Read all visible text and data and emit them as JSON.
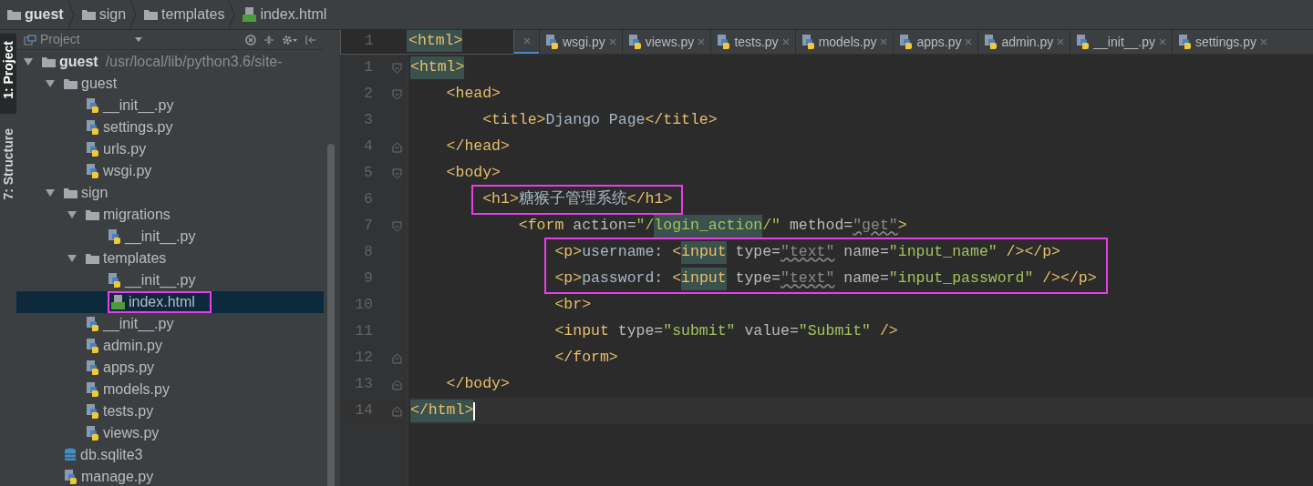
{
  "breadcrumb": [
    {
      "label": "guest",
      "kind": "folder",
      "bold": true
    },
    {
      "label": "sign",
      "kind": "folder",
      "bold": false
    },
    {
      "label": "templates",
      "kind": "folder",
      "bold": false
    },
    {
      "label": "index.html",
      "kind": "html",
      "bold": false
    }
  ],
  "tool_strip": [
    {
      "label": "1: Project",
      "selected": true
    },
    {
      "label": "7: Structure",
      "selected": false
    }
  ],
  "project_panel": {
    "title": "Project",
    "tree": [
      {
        "label": "guest",
        "path": "/usr/local/lib/python3.6/site-",
        "kind": "folder",
        "bold": true,
        "expanded": true,
        "selected": false,
        "boxed": false,
        "children": [
          {
            "label": "guest",
            "kind": "folder",
            "expanded": true,
            "selected": false,
            "boxed": false,
            "children": [
              {
                "label": "__init__.py",
                "kind": "python",
                "selected": false,
                "boxed": false
              },
              {
                "label": "settings.py",
                "kind": "python",
                "selected": false,
                "boxed": false
              },
              {
                "label": "urls.py",
                "kind": "python",
                "selected": false,
                "boxed": false
              },
              {
                "label": "wsgi.py",
                "kind": "python",
                "selected": false,
                "boxed": false
              }
            ]
          },
          {
            "label": "sign",
            "kind": "folder",
            "expanded": true,
            "selected": false,
            "boxed": false,
            "children": [
              {
                "label": "migrations",
                "kind": "folder",
                "expanded": true,
                "selected": false,
                "boxed": false,
                "children": [
                  {
                    "label": "__init__.py",
                    "kind": "python",
                    "selected": false,
                    "boxed": false
                  }
                ]
              },
              {
                "label": "templates",
                "kind": "folder",
                "expanded": true,
                "selected": false,
                "boxed": false,
                "children": [
                  {
                    "label": "__init__.py",
                    "kind": "python",
                    "selected": false,
                    "boxed": false
                  },
                  {
                    "label": "index.html",
                    "kind": "html",
                    "selected": true,
                    "boxed": true
                  }
                ]
              },
              {
                "label": "__init__.py",
                "kind": "python",
                "selected": false,
                "boxed": false
              },
              {
                "label": "admin.py",
                "kind": "python",
                "selected": false,
                "boxed": false
              },
              {
                "label": "apps.py",
                "kind": "python",
                "selected": false,
                "boxed": false
              },
              {
                "label": "models.py",
                "kind": "python",
                "selected": false,
                "boxed": false
              },
              {
                "label": "tests.py",
                "kind": "python",
                "selected": false,
                "boxed": false
              },
              {
                "label": "views.py",
                "kind": "python",
                "selected": false,
                "boxed": false
              }
            ]
          },
          {
            "label": "db.sqlite3",
            "kind": "db",
            "selected": false,
            "boxed": false
          },
          {
            "label": "manage.py",
            "kind": "python",
            "selected": false,
            "boxed": false
          }
        ]
      }
    ]
  },
  "tabs": [
    {
      "label": "wsgi.py",
      "selected": false
    },
    {
      "label": "views.py",
      "selected": false
    },
    {
      "label": "tests.py",
      "selected": false
    },
    {
      "label": "models.py",
      "selected": false
    },
    {
      "label": "apps.py",
      "selected": false
    },
    {
      "label": "admin.py",
      "selected": false
    },
    {
      "label": "__init__.py",
      "selected": false
    },
    {
      "label": "settings.py",
      "selected": false
    }
  ],
  "editor": {
    "sticky_line": {
      "number": "1",
      "text": "<html>"
    },
    "lines": [
      {
        "number": "1",
        "fold_start": true,
        "boxed": false,
        "tokens": [
          {
            "kind": "tag",
            "text": "<html>",
            "highlighted": true
          }
        ]
      },
      {
        "number": "2",
        "fold_start": true,
        "boxed": false,
        "tokens": [
          {
            "kind": "tag",
            "text": "    <head>"
          }
        ]
      },
      {
        "number": "3",
        "boxed": false,
        "tokens": [
          {
            "kind": "tag",
            "text": "        <title>"
          },
          {
            "kind": "text",
            "text": "Django Page"
          },
          {
            "kind": "tag",
            "text": "</title>"
          }
        ]
      },
      {
        "number": "4",
        "fold_end": true,
        "boxed": false,
        "tokens": [
          {
            "kind": "tag",
            "text": "    </head>"
          }
        ]
      },
      {
        "number": "5",
        "fold_start": true,
        "boxed": false,
        "tokens": [
          {
            "kind": "tag",
            "text": "    <body>"
          }
        ]
      },
      {
        "number": "6",
        "boxed": true,
        "tokens": [
          {
            "kind": "tag",
            "text": "        <h1>"
          },
          {
            "kind": "text",
            "text": "糖猴子管理系统"
          },
          {
            "kind": "tag",
            "text": "</h1>"
          }
        ]
      },
      {
        "number": "7",
        "fold_start": true,
        "boxed": false,
        "tokens": [
          {
            "kind": "tag",
            "text": "            <form"
          },
          {
            "kind": "attr",
            "text": " action="
          },
          {
            "kind": "value",
            "text": "\"/"
          },
          {
            "kind": "value",
            "text": "login_action",
            "highlighted": true
          },
          {
            "kind": "value",
            "text": "/\""
          },
          {
            "kind": "attr",
            "text": " method="
          },
          {
            "kind": "warn",
            "text": "\"get\""
          },
          {
            "kind": "tag",
            "text": ">"
          }
        ]
      },
      {
        "number": "8",
        "boxed": true,
        "tokens": [
          {
            "kind": "tag",
            "text": "                <p>"
          },
          {
            "kind": "text",
            "text": "username: "
          },
          {
            "kind": "tag",
            "text": "<"
          },
          {
            "kind": "tag",
            "text": "input",
            "highlighted": true
          },
          {
            "kind": "attr",
            "text": " type="
          },
          {
            "kind": "warn",
            "text": "\"text\""
          },
          {
            "kind": "attr",
            "text": " name="
          },
          {
            "kind": "value",
            "text": "\"input_name\""
          },
          {
            "kind": "tag",
            "text": " /></p>"
          }
        ]
      },
      {
        "number": "9",
        "boxed": true,
        "tokens": [
          {
            "kind": "tag",
            "text": "                <p>"
          },
          {
            "kind": "text",
            "text": "password: "
          },
          {
            "kind": "tag",
            "text": "<"
          },
          {
            "kind": "tag",
            "text": "input",
            "highlighted": true
          },
          {
            "kind": "attr",
            "text": " type="
          },
          {
            "kind": "warn",
            "text": "\"text\""
          },
          {
            "kind": "attr",
            "text": " name="
          },
          {
            "kind": "value",
            "text": "\"input_password\""
          },
          {
            "kind": "tag",
            "text": " /></p>"
          }
        ]
      },
      {
        "number": "10",
        "boxed": false,
        "tokens": [
          {
            "kind": "tag",
            "text": "                <br>"
          }
        ]
      },
      {
        "number": "11",
        "boxed": false,
        "tokens": [
          {
            "kind": "tag",
            "text": "                <input"
          },
          {
            "kind": "attr",
            "text": " type="
          },
          {
            "kind": "value",
            "text": "\"submit\""
          },
          {
            "kind": "attr",
            "text": " value="
          },
          {
            "kind": "value",
            "text": "\"Submit\""
          },
          {
            "kind": "tag",
            "text": " />"
          }
        ]
      },
      {
        "number": "12",
        "fold_end": true,
        "boxed": false,
        "tokens": [
          {
            "kind": "tag",
            "text": "                </form>"
          }
        ]
      },
      {
        "number": "13",
        "fold_end": true,
        "boxed": false,
        "tokens": [
          {
            "kind": "tag",
            "text": "    </body>"
          }
        ]
      },
      {
        "number": "14",
        "fold_end": true,
        "boxed": false,
        "caret": true,
        "tokens": [
          {
            "kind": "tag",
            "text": "</html>",
            "highlighted": true
          }
        ]
      }
    ]
  }
}
